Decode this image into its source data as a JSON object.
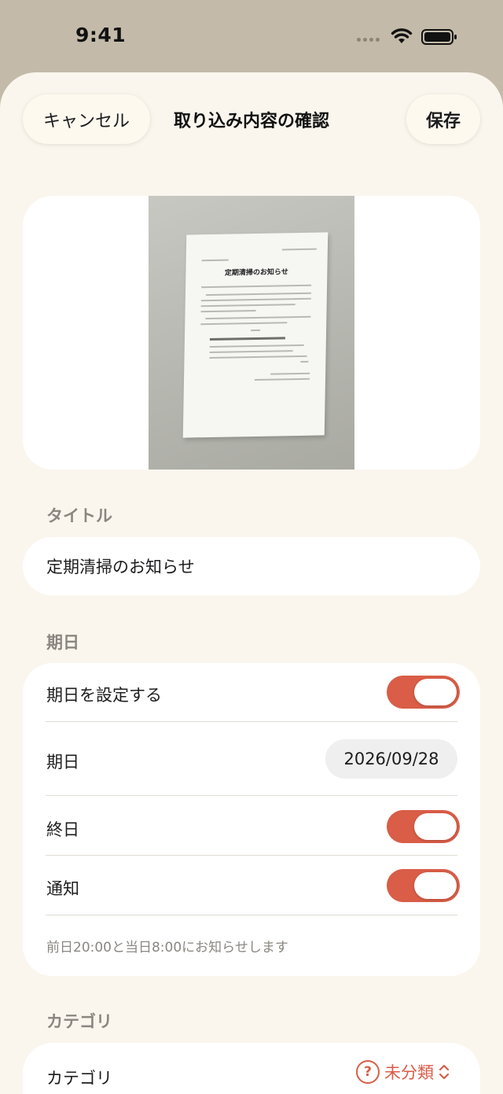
{
  "status_bar": {
    "time": "9:41"
  },
  "nav": {
    "cancel_label": "キャンセル",
    "title": "取り込み内容の確認",
    "save_label": "保存"
  },
  "photo": {
    "document_title": "定期清掃のお知らせ"
  },
  "title_section": {
    "label": "タイトル",
    "value": "定期清掃のお知らせ"
  },
  "due_section": {
    "label": "期日",
    "set_due_label": "期日を設定する",
    "set_due_on": true,
    "date_label": "期日",
    "date_value": "2026/09/28",
    "all_day_label": "終日",
    "all_day_on": true,
    "notify_label": "通知",
    "notify_on": true,
    "notify_note": "前日20:00と当日8:00にお知らせします"
  },
  "category_section": {
    "label": "カテゴリ",
    "row_label": "カテゴリ",
    "value": "未分類",
    "icon": "question-circle-icon"
  },
  "colors": {
    "accent": "#d95d47",
    "background": "#faf6ee",
    "header": "#c3baa9"
  }
}
